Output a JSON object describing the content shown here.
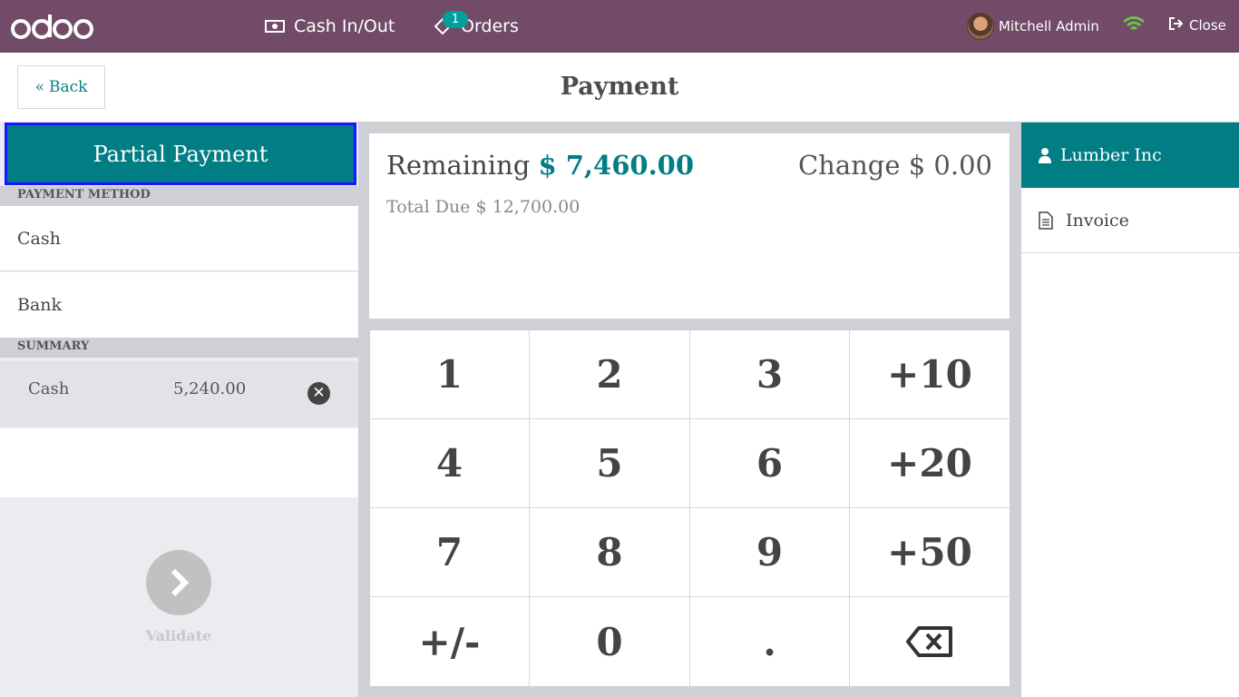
{
  "navbar": {
    "logo_text": "odoo",
    "cash_in_out_label": "Cash In/Out",
    "orders_label": "Orders",
    "orders_badge": "1",
    "user_name": "Mitchell Admin",
    "close_label": "Close"
  },
  "header": {
    "back_label": "Back",
    "title": "Payment"
  },
  "left": {
    "partial_payment_label": "Partial Payment",
    "payment_method_heading": "PAYMENT METHOD",
    "methods": [
      "Cash",
      "Bank"
    ],
    "summary_heading": "SUMMARY",
    "summary_lines": [
      {
        "name": "Cash",
        "amount": "5,240.00"
      }
    ],
    "validate_label": "Validate"
  },
  "info": {
    "remaining_label": "Remaining",
    "remaining_amount": "$ 7,460.00",
    "change_label": "Change",
    "change_amount": "$ 0.00",
    "total_due_label": "Total Due",
    "total_due_amount": "$ 12,700.00"
  },
  "numpad": {
    "keys": [
      "1",
      "2",
      "3",
      "+10",
      "4",
      "5",
      "6",
      "+20",
      "7",
      "8",
      "9",
      "+50",
      "+/-",
      "0",
      ".",
      "backspace-icon"
    ]
  },
  "right": {
    "customer_name": "Lumber Inc",
    "invoice_label": "Invoice"
  },
  "colors": {
    "navbar": "#714b67",
    "accent": "#017e84",
    "focus_border": "#1a14ff",
    "wifi": "#6cc04a"
  }
}
